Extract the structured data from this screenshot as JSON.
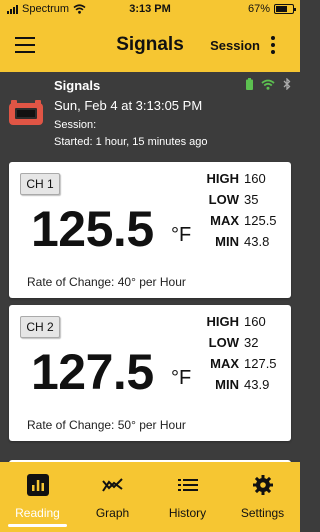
{
  "status_bar": {
    "carrier": "Spectrum",
    "time": "3:13 PM",
    "battery_text": "67%",
    "battery_level": 0.67
  },
  "nav": {
    "title": "Signals",
    "session_label": "Session",
    "menu_icon": "hamburger-menu-icon",
    "more_icon": "vertical-dots-icon"
  },
  "device": {
    "name": "Signals",
    "date": "Sun, Feb 4  at 3:13:05 PM",
    "session_label": "Session:",
    "started": "Started: 1 hour, 15 minutes ago",
    "icon": "thermometer-device-icon",
    "status_icons": [
      "battery-icon",
      "wifi-icon",
      "bluetooth-icon"
    ],
    "colors": {
      "device": "#e05545",
      "battery": "#5cc050",
      "wifi": "#5cc050",
      "bluetooth": "#aaaaaa"
    }
  },
  "channels": [
    {
      "id": "CH 1",
      "value": "125.5",
      "unit": "°F",
      "rate": "Rate of Change: 40° per Hour",
      "stats": [
        {
          "label": "HIGH",
          "value": "160"
        },
        {
          "label": "LOW",
          "value": "35"
        },
        {
          "label": "MAX",
          "value": "125.5"
        },
        {
          "label": "MIN",
          "value": "43.8"
        }
      ]
    },
    {
      "id": "CH 2",
      "value": "127.5",
      "unit": "°F",
      "rate": "Rate of Change: 50° per Hour",
      "stats": [
        {
          "label": "HIGH",
          "value": "160"
        },
        {
          "label": "LOW",
          "value": "32"
        },
        {
          "label": "MAX",
          "value": "127.5"
        },
        {
          "label": "MIN",
          "value": "43.9"
        }
      ]
    }
  ],
  "tabs": [
    {
      "label": "Reading",
      "icon": "bar-chart-icon",
      "active": true
    },
    {
      "label": "Graph",
      "icon": "line-graph-icon",
      "active": false
    },
    {
      "label": "History",
      "icon": "list-icon",
      "active": false
    },
    {
      "label": "Settings",
      "icon": "gear-icon",
      "active": false
    }
  ],
  "colors": {
    "accent": "#f6c632",
    "background": "#3c3c3c",
    "card": "#ffffff"
  }
}
